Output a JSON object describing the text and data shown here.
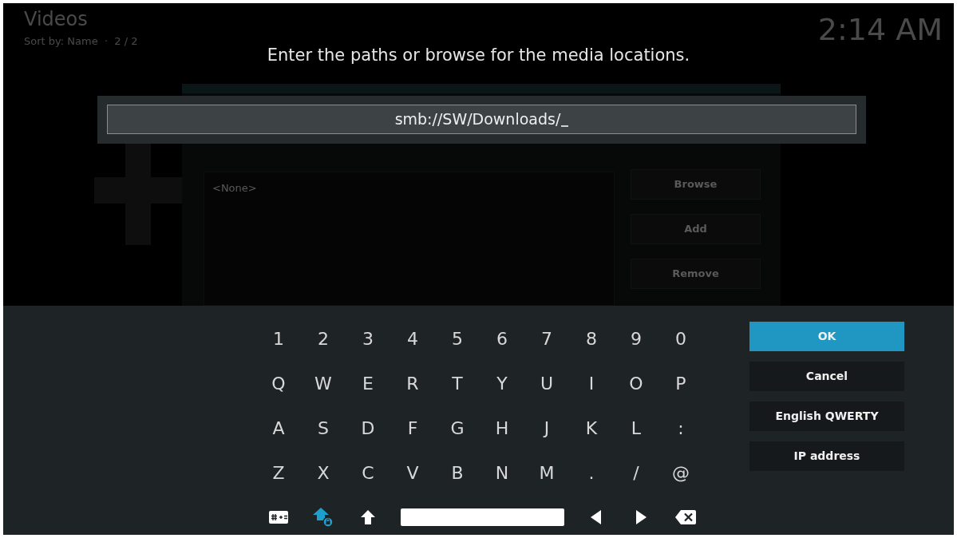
{
  "background": {
    "title": "Videos",
    "subtitle": "Sort by: Name  ·  2 / 2",
    "clock": "2:14 AM",
    "list_items": [
      "<None>"
    ],
    "buttons": [
      "Browse",
      "Add",
      "Remove"
    ]
  },
  "dialog": {
    "heading": "Enter the paths or browse for the media locations.",
    "input": {
      "value": "smb://SW/Downloads/",
      "cursor": true
    }
  },
  "keyboard": {
    "rows": [
      [
        "1",
        "2",
        "3",
        "4",
        "5",
        "6",
        "7",
        "8",
        "9",
        "0"
      ],
      [
        "Q",
        "W",
        "E",
        "R",
        "T",
        "Y",
        "U",
        "I",
        "O",
        "P"
      ],
      [
        "A",
        "S",
        "D",
        "F",
        "G",
        "H",
        "J",
        "K",
        "L",
        ":"
      ],
      [
        "Z",
        "X",
        "C",
        "V",
        "B",
        "N",
        "M",
        ".",
        "/",
        "@"
      ]
    ],
    "special_keys": [
      {
        "kind": "symbols",
        "on": false
      },
      {
        "kind": "capslock",
        "on": true
      },
      {
        "kind": "shift",
        "on": false
      },
      {
        "kind": "space",
        "on": false
      },
      {
        "kind": "left",
        "on": false
      },
      {
        "kind": "right",
        "on": false
      },
      {
        "kind": "backspace",
        "on": false
      }
    ]
  },
  "buttons": [
    {
      "label": "OK",
      "selected": true
    },
    {
      "label": "Cancel",
      "selected": false
    },
    {
      "label": "English QWERTY",
      "selected": false
    },
    {
      "label": "IP address",
      "selected": false
    }
  ]
}
